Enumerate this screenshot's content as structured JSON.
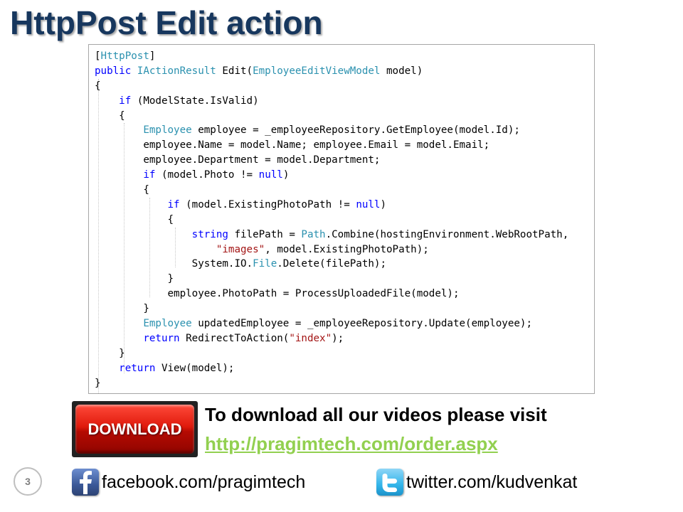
{
  "title": "HttpPost Edit action",
  "code": {
    "lines": [
      {
        "tokens": [
          {
            "t": "[",
            "c": "plain"
          },
          {
            "t": "HttpPost",
            "c": "type"
          },
          {
            "t": "]",
            "c": "plain"
          }
        ]
      },
      {
        "tokens": [
          {
            "t": "public",
            "c": "keyword"
          },
          {
            "t": " ",
            "c": "plain"
          },
          {
            "t": "IActionResult",
            "c": "type"
          },
          {
            "t": " Edit(",
            "c": "plain"
          },
          {
            "t": "EmployeeEditViewModel",
            "c": "type"
          },
          {
            "t": " model)",
            "c": "plain"
          }
        ]
      },
      {
        "tokens": [
          {
            "t": "{",
            "c": "plain"
          }
        ]
      },
      {
        "tokens": [
          {
            "t": "    ",
            "c": "plain"
          },
          {
            "t": "if",
            "c": "keyword"
          },
          {
            "t": " (ModelState.IsValid)",
            "c": "plain"
          }
        ]
      },
      {
        "tokens": [
          {
            "t": "    {",
            "c": "plain"
          }
        ]
      },
      {
        "tokens": [
          {
            "t": "        ",
            "c": "plain"
          },
          {
            "t": "Employee",
            "c": "type"
          },
          {
            "t": " employee = _employeeRepository.GetEmployee(model.Id);",
            "c": "plain"
          }
        ]
      },
      {
        "tokens": [
          {
            "t": "        employee.Name = model.Name; employee.Email = model.Email;",
            "c": "plain"
          }
        ]
      },
      {
        "tokens": [
          {
            "t": "        employee.Department = model.Department;",
            "c": "plain"
          }
        ]
      },
      {
        "tokens": [
          {
            "t": "        ",
            "c": "plain"
          },
          {
            "t": "if",
            "c": "keyword"
          },
          {
            "t": " (model.Photo != ",
            "c": "plain"
          },
          {
            "t": "null",
            "c": "keyword"
          },
          {
            "t": ")",
            "c": "plain"
          }
        ]
      },
      {
        "tokens": [
          {
            "t": "        {",
            "c": "plain"
          }
        ]
      },
      {
        "tokens": [
          {
            "t": "            ",
            "c": "plain"
          },
          {
            "t": "if",
            "c": "keyword"
          },
          {
            "t": " (model.ExistingPhotoPath != ",
            "c": "plain"
          },
          {
            "t": "null",
            "c": "keyword"
          },
          {
            "t": ")",
            "c": "plain"
          }
        ]
      },
      {
        "tokens": [
          {
            "t": "            {",
            "c": "plain"
          }
        ]
      },
      {
        "tokens": [
          {
            "t": "                ",
            "c": "plain"
          },
          {
            "t": "string",
            "c": "keyword"
          },
          {
            "t": " filePath = ",
            "c": "plain"
          },
          {
            "t": "Path",
            "c": "type"
          },
          {
            "t": ".Combine(hostingEnvironment.WebRootPath,",
            "c": "plain"
          }
        ]
      },
      {
        "tokens": [
          {
            "t": "                    ",
            "c": "plain"
          },
          {
            "t": "\"images\"",
            "c": "string"
          },
          {
            "t": ", model.ExistingPhotoPath);",
            "c": "plain"
          }
        ]
      },
      {
        "tokens": [
          {
            "t": "                System.IO.",
            "c": "plain"
          },
          {
            "t": "File",
            "c": "type"
          },
          {
            "t": ".Delete(filePath);",
            "c": "plain"
          }
        ]
      },
      {
        "tokens": [
          {
            "t": "            }",
            "c": "plain"
          }
        ]
      },
      {
        "tokens": [
          {
            "t": "            employee.PhotoPath = ProcessUploadedFile(model);",
            "c": "plain"
          }
        ]
      },
      {
        "tokens": [
          {
            "t": "        }",
            "c": "plain"
          }
        ]
      },
      {
        "tokens": [
          {
            "t": "        ",
            "c": "plain"
          },
          {
            "t": "Employee",
            "c": "type"
          },
          {
            "t": " updatedEmployee = _employeeRepository.Update(employee);",
            "c": "plain"
          }
        ]
      },
      {
        "tokens": [
          {
            "t": "        ",
            "c": "plain"
          },
          {
            "t": "return",
            "c": "keyword"
          },
          {
            "t": " RedirectToAction(",
            "c": "plain"
          },
          {
            "t": "\"index\"",
            "c": "string"
          },
          {
            "t": ");",
            "c": "plain"
          }
        ]
      },
      {
        "tokens": [
          {
            "t": "    }",
            "c": "plain"
          }
        ]
      },
      {
        "tokens": [
          {
            "t": "    ",
            "c": "plain"
          },
          {
            "t": "return",
            "c": "keyword"
          },
          {
            "t": " View(model);",
            "c": "plain"
          }
        ]
      },
      {
        "tokens": [
          {
            "t": "}",
            "c": "plain"
          }
        ]
      }
    ]
  },
  "download": {
    "badge_text": "DOWNLOAD",
    "promo_text": "To download all our videos please visit",
    "link_text": "http://pragimtech.com/order.aspx"
  },
  "footer": {
    "slide_number": "3",
    "facebook_text": "facebook.com/pragimtech",
    "twitter_text": "twitter.com/kudvenkat"
  },
  "colors": {
    "title": "#17375e",
    "keyword": "#0000ff",
    "type": "#2b91af",
    "string": "#a31515",
    "link": "#92d050",
    "download_red": "#e01a0c"
  },
  "icons": {
    "facebook": "facebook-icon",
    "twitter": "twitter-icon"
  }
}
